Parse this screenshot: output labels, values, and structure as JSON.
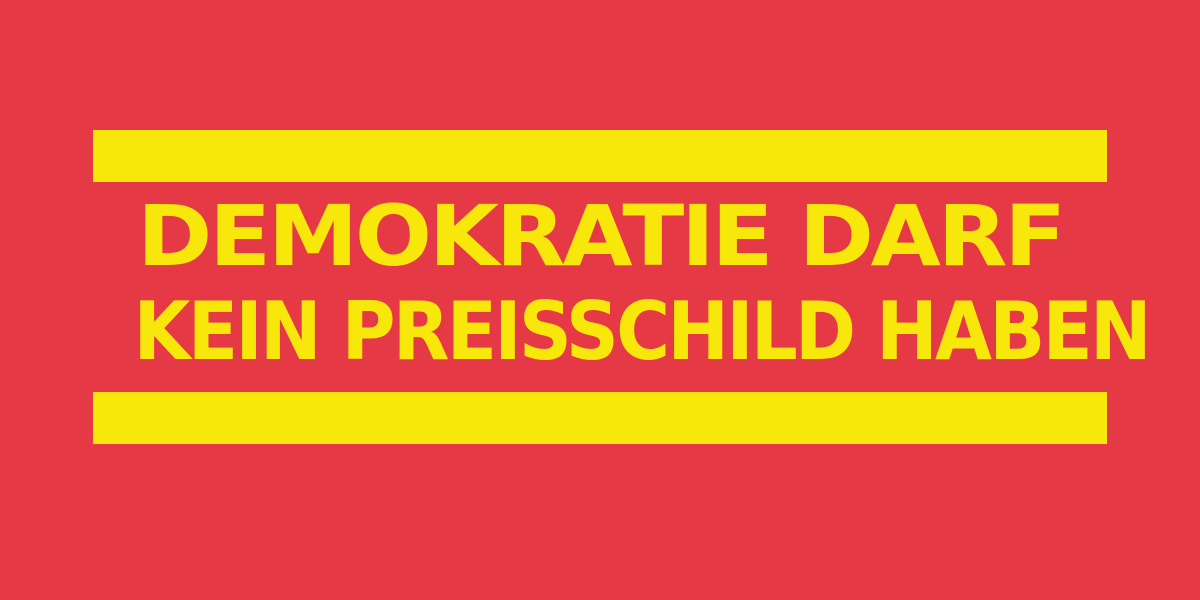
{
  "poster": {
    "line_1": "DEMOKRATIE DARF",
    "line_2": "KEIN PREISSCHILD HABEN",
    "background_color": "#e63946",
    "accent_color": "#f7e70a"
  }
}
